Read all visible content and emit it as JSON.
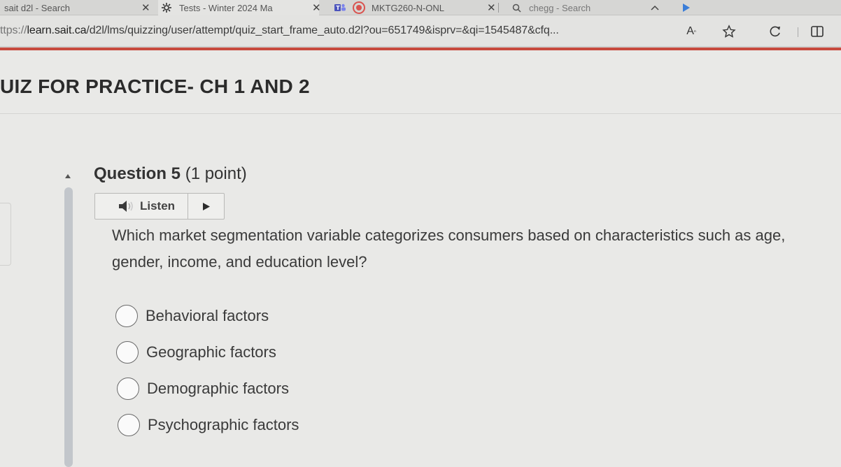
{
  "browser": {
    "tabs": [
      {
        "label": "sait d2l - Search",
        "icon": "none",
        "closable": true
      },
      {
        "label": "Tests - Winter 2024 Ma",
        "icon": "gear-flower-icon",
        "closable": true
      },
      {
        "label": "MKTG260-N-ONL",
        "icon": "teams-icon",
        "closable": true
      },
      {
        "label": "chegg - Search",
        "icon": "search-icon",
        "closable": false
      }
    ],
    "url": {
      "prefix": "ttps://",
      "host": "learn.sait.ca",
      "path": "/d2l/lms/quizzing/user/attempt/quiz_start_frame_auto.d2l?ou=651749&isprv=&qi=1545487&cfq..."
    },
    "reader_icon_label": "A",
    "accent_color": "#c74a3d"
  },
  "quiz": {
    "title": "UIZ FOR PRACTICE- CH 1 AND 2"
  },
  "question": {
    "heading": "Question 5",
    "points": "(1 point)",
    "listen_label": "Listen",
    "text": "Which market segmentation variable categorizes consumers based on characteristics such as age, gender, income, and education level?",
    "options": [
      {
        "label": "Behavioral factors",
        "selected": false
      },
      {
        "label": "Geographic factors",
        "selected": false
      },
      {
        "label": "Demographic factors",
        "selected": false
      },
      {
        "label": "Psychographic factors",
        "selected": false
      }
    ]
  }
}
